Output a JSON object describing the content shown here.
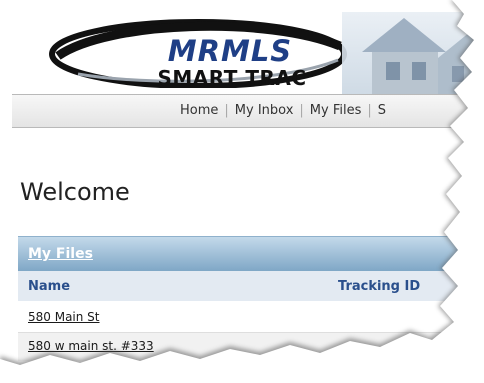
{
  "logo": {
    "line1": "MRMLS",
    "line2": "SMART TRAC"
  },
  "nav": {
    "items": [
      "Home",
      "My Inbox",
      "My Files",
      "S"
    ]
  },
  "welcome": "Welcome",
  "my_files": {
    "title": "My Files",
    "columns": [
      "Name",
      "Tracking ID"
    ],
    "rows": [
      {
        "name": "580 Main St"
      },
      {
        "name": "580 w main st. #333"
      }
    ]
  },
  "colors": {
    "logo_blue": "#1f3f86",
    "panel_header": "#7fa7c6",
    "column_text": "#2a4f8c"
  }
}
